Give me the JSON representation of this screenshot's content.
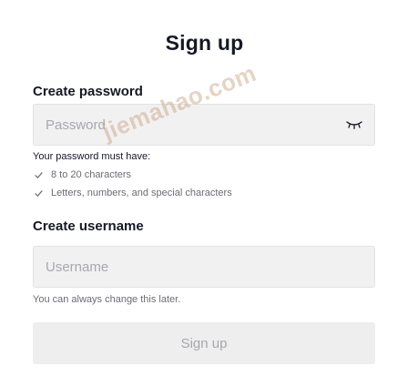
{
  "page": {
    "title": "Sign up"
  },
  "password": {
    "label": "Create password",
    "placeholder": "Password",
    "toggle_icon": "eye-closed-icon",
    "requirements_heading": "Your password must have:",
    "requirements": [
      "8 to 20 characters",
      "Letters, numbers, and special characters"
    ]
  },
  "username": {
    "label": "Create username",
    "placeholder": "Username",
    "helper": "You can always change this later."
  },
  "submit": {
    "label": "Sign up"
  },
  "watermark": {
    "text": "jiemahao.com"
  },
  "colors": {
    "text_primary": "#161823",
    "text_secondary": "#6b6d74",
    "field_bg": "#f1f1f2",
    "button_disabled_bg": "#eeeeef",
    "button_disabled_text": "#a6a7ab"
  }
}
